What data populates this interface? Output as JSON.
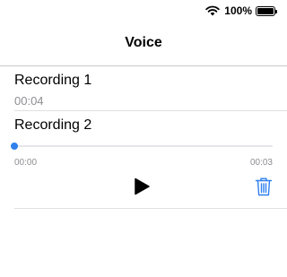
{
  "status_bar": {
    "wifi_icon": "wifi-icon",
    "battery_percent": "100%",
    "battery_level": 1.0
  },
  "nav": {
    "title": "Voice"
  },
  "recordings": [
    {
      "title": "Recording 1",
      "duration": "00:04"
    },
    {
      "title": "Recording 2",
      "player": {
        "current_time": "00:00",
        "total_time": "00:03",
        "progress": 0,
        "play_icon": "play-icon",
        "delete_icon": "trash-icon"
      }
    }
  ],
  "colors": {
    "accent": "#2f80ed",
    "secondary_text": "#8e8e93",
    "divider": "#c8c8cc"
  }
}
